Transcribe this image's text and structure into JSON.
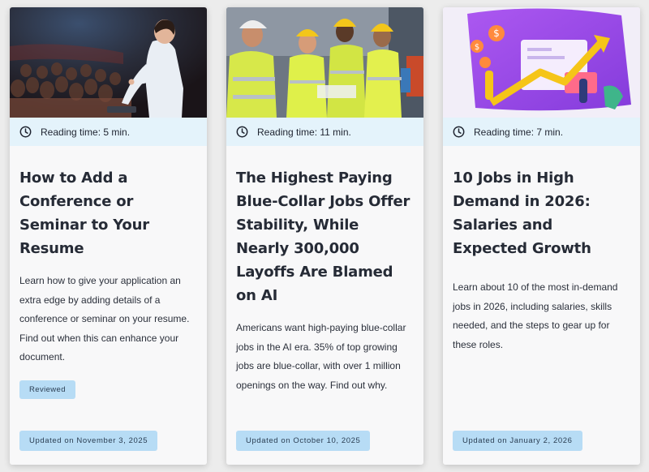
{
  "articles": [
    {
      "image": "conference-speaker-photo",
      "reading_time": "Reading time: 5 min.",
      "title": "How to Add a Conference or Seminar to Your Resume",
      "description": "Learn how to give your application an extra edge by adding details of a conference or seminar on your resume. Find out when this can enhance your document.",
      "badge": "Reviewed",
      "updated": "Updated on November 3, 2025"
    },
    {
      "image": "construction-workers-photo",
      "reading_time": "Reading time: 11 min.",
      "title": "The Highest Paying Blue-Collar Jobs Offer Stability, While Nearly 300,000 Layoffs Are Blamed on AI",
      "description": "Americans want high-paying blue-collar jobs in the AI era. 35% of top growing jobs are blue-collar, with over 1 million openings on the way. Find out why.",
      "updated": "Updated on October 10, 2025"
    },
    {
      "image": "growth-chart-illustration",
      "reading_time": "Reading time: 7 min.",
      "title": "10 Jobs in High Demand in 2026: Salaries and Expected Growth",
      "description": "Learn about 10 of the most in-demand jobs in 2026, including salaries, skills needed, and the steps to gear up for these roles.",
      "updated": "Updated on January 2, 2026"
    }
  ],
  "colors": {
    "reading_bar": "#e4f3fb",
    "badge": "#b7dcf5",
    "card": "#f8f8f9",
    "background": "#ececec"
  },
  "icons": {
    "reading_time": "clock-icon"
  }
}
